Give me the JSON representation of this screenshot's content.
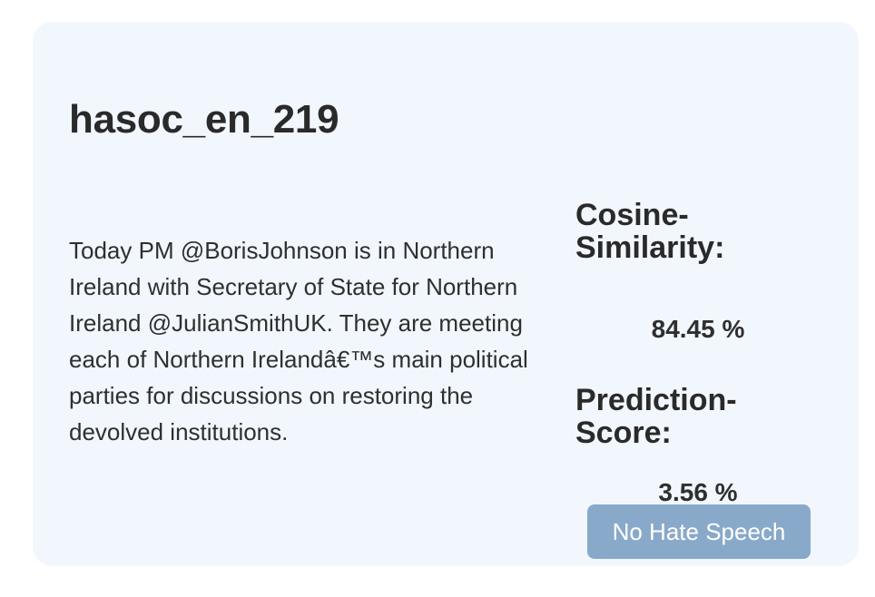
{
  "card": {
    "title": "hasoc_en_219",
    "tweet_text": "Today PM @BorisJohnson is in Northern Ireland with Secretary of State for Northern Ireland @JulianSmithUK. They are meeting each of Northern Irelandâ€™s main political parties for discussions on restoring the devolved institutions.",
    "cosine_similarity": {
      "label": "Cosine-Similarity:",
      "value": "84.45 %"
    },
    "prediction_score": {
      "label": "Prediction-Score:",
      "value": "3.56 %"
    },
    "classification": {
      "label": "No Hate Speech"
    }
  },
  "colors": {
    "card_background": "#f1f7fd",
    "badge_background": "#89a9ca",
    "badge_text": "#ffffff",
    "text": "#2b2b2b"
  }
}
